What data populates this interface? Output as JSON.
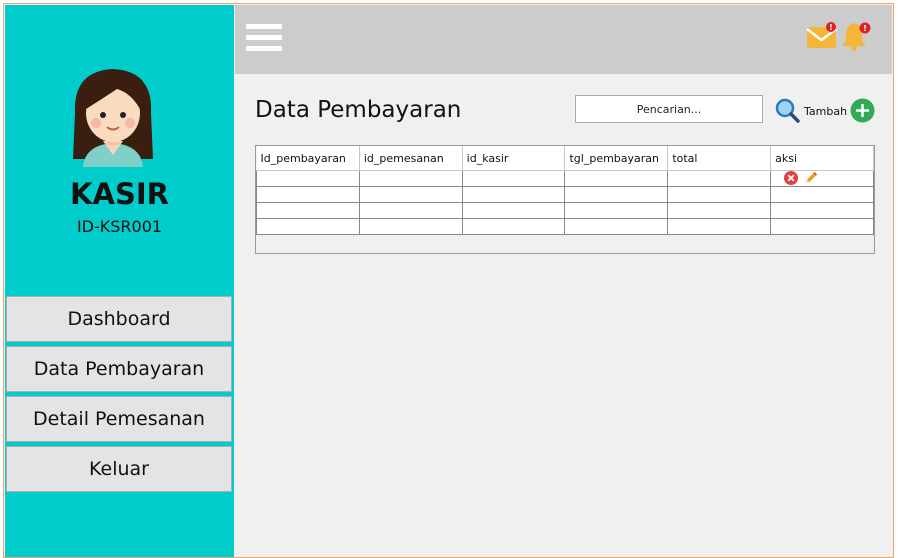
{
  "profile": {
    "role": "KASIR",
    "id": "ID-KSR001"
  },
  "menu": [
    {
      "label": "Dashboard"
    },
    {
      "label": "Data Pembayaran"
    },
    {
      "label": "Detail Pemesanan"
    },
    {
      "label": "Keluar"
    }
  ],
  "topbar": {
    "menu_icon": "hamburger-menu-icon",
    "mail_icon": "mail-icon",
    "mail_badge": "!",
    "bell_icon": "bell-icon",
    "bell_badge": "!"
  },
  "main": {
    "title": "Data Pembayaran",
    "search_placeholder": "Pencarian...",
    "search_icon": "magnifier-icon",
    "add_label": "Tambah",
    "add_icon": "plus-circle-icon"
  },
  "table": {
    "columns": [
      "Id_pembayaran",
      "id_pemesanan",
      "id_kasir",
      "tgl_pembayaran",
      "total",
      "aksi"
    ],
    "action_icons": [
      "delete-icon",
      "edit-pencil-icon"
    ]
  },
  "colors": {
    "sidebar": "#00cccc",
    "topbar": "#cccccc",
    "content": "#f0f0f0",
    "add_button": "#33aa55",
    "delete_icon": "#e04040",
    "badge": "#dd2222"
  }
}
